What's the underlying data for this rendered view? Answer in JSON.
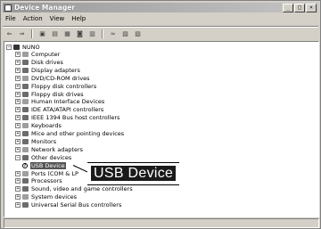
{
  "window": {
    "title": "Device Manager",
    "controls": [
      "_",
      "□",
      "×"
    ]
  },
  "menu": {
    "items": [
      "File",
      "Action",
      "View",
      "Help"
    ]
  },
  "toolbar": {
    "icons": [
      "back-icon",
      "forward-icon",
      "up-icon",
      "properties-icon",
      "print-icon",
      "help-icon",
      "scan-icon",
      "update-icon",
      "disable-icon",
      "uninstall-icon"
    ]
  },
  "tree": {
    "root": "NUNO",
    "items": [
      {
        "label": "Computer",
        "exp": "+"
      },
      {
        "label": "Disk drives",
        "exp": "+"
      },
      {
        "label": "Display adapters",
        "exp": "+"
      },
      {
        "label": "DVD/CD-ROM drives",
        "exp": "+"
      },
      {
        "label": "Floppy disk controllers",
        "exp": "+"
      },
      {
        "label": "Floppy disk drives",
        "exp": "+"
      },
      {
        "label": "Human Interface Devices",
        "exp": "+"
      },
      {
        "label": "IDE ATA/ATAPI controllers",
        "exp": "+"
      },
      {
        "label": "IEEE 1394 Bus host controllers",
        "exp": "+"
      },
      {
        "label": "Keyboards",
        "exp": "+"
      },
      {
        "label": "Mice and other pointing devices",
        "exp": "+"
      },
      {
        "label": "Monitors",
        "exp": "+"
      },
      {
        "label": "Network adapters",
        "exp": "+"
      },
      {
        "label": "Other devices",
        "exp": "-"
      },
      {
        "label": "USB Device",
        "exp": "",
        "child": true
      },
      {
        "label": "Ports (COM & LP",
        "exp": "+"
      },
      {
        "label": "Processors",
        "exp": "+"
      },
      {
        "label": "Sound, video and game controllers",
        "exp": "+"
      },
      {
        "label": "System devices",
        "exp": "+"
      },
      {
        "label": "Universal Serial Bus controllers",
        "exp": "+"
      }
    ]
  },
  "callout": {
    "text": "USB Device"
  },
  "colors": {
    "title_gradient_start": "#9a9a9a",
    "title_gradient_end": "#c4c4c4",
    "selection": "#555555"
  }
}
